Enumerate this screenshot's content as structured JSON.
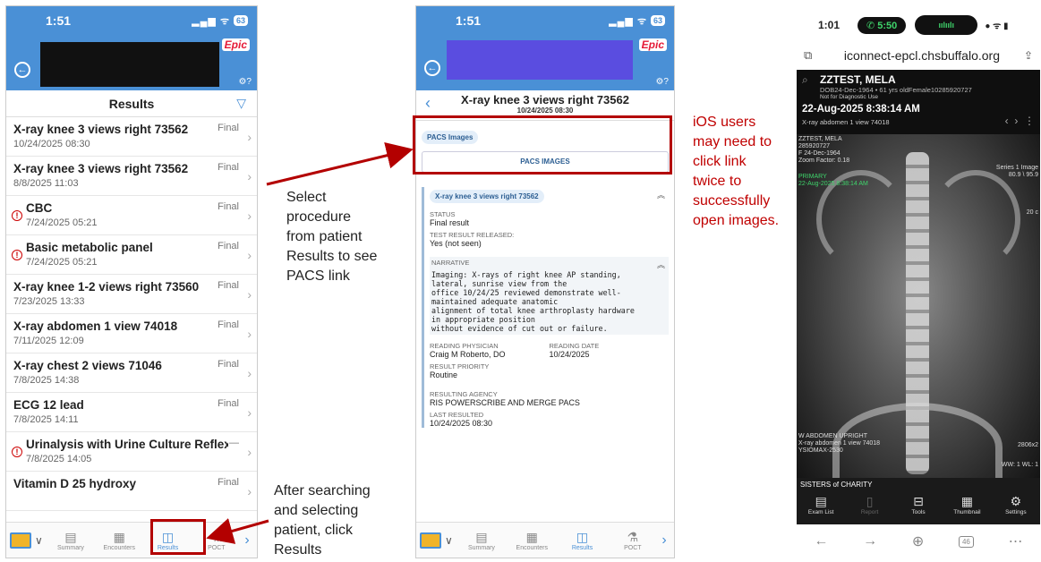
{
  "phone1": {
    "status_time": "1:51",
    "battery": "63",
    "header_logo": "Epic",
    "screen_title": "Results",
    "results": [
      {
        "name": "X-ray knee 3 views right 73562",
        "date": "10/24/2025 08:30",
        "status": "Final",
        "alert": false
      },
      {
        "name": "X-ray knee 3 views right 73562",
        "date": "8/8/2025 11:03",
        "status": "Final",
        "alert": false
      },
      {
        "name": "CBC",
        "date": "7/24/2025 05:21",
        "status": "Final",
        "alert": true
      },
      {
        "name": "Basic metabolic panel",
        "date": "7/24/2025 05:21",
        "status": "Final",
        "alert": true
      },
      {
        "name": "X-ray knee 1-2 views right 73560",
        "date": "7/23/2025 13:33",
        "status": "Final",
        "alert": false
      },
      {
        "name": "X-ray abdomen 1 view 74018",
        "date": "7/11/2025 12:09",
        "status": "Final",
        "alert": false
      },
      {
        "name": "X-ray chest 2 views 71046",
        "date": "7/8/2025 14:38",
        "status": "Final",
        "alert": false
      },
      {
        "name": "ECG 12 lead",
        "date": "7/8/2025 14:11",
        "status": "Final",
        "alert": false
      },
      {
        "name": "Urinalysis with Urine Culture Reflex",
        "date": "7/8/2025 14:05",
        "status": "—",
        "alert": true
      },
      {
        "name": "Vitamin D 25 hydroxy",
        "date": "",
        "status": "Final",
        "alert": false
      }
    ],
    "tabs": [
      "Summary",
      "Encounters",
      "Results",
      "POCT"
    ]
  },
  "phone2": {
    "status_time": "1:51",
    "battery": "63",
    "header_logo": "Epic",
    "title": "X-ray knee 3 views right 73562",
    "subtitle": "10/24/2025 08:30",
    "pacs_chip": "PACS Images",
    "pacs_button": "PACS IMAGES",
    "section_chip": "X-ray knee 3 views right 73562",
    "status_label": "STATUS",
    "status_value": "Final result",
    "released_label": "TEST RESULT RELEASED:",
    "released_value": "Yes (not seen)",
    "narrative_label": "NARRATIVE",
    "narrative": "Imaging: X-rays of right knee AP standing,\nlateral, sunrise view from the\noffice 10/24/25 reviewed demonstrate well-\nmaintained adequate anatomic\nalignment of total knee arthroplasty hardware\nin appropriate position\nwithout evidence of cut out or failure.",
    "reading_physician_label": "READING PHYSICIAN",
    "reading_physician": "Craig M Roberto, DO",
    "reading_date_label": "READING DATE",
    "reading_date": "10/24/2025",
    "priority_label": "RESULT PRIORITY",
    "priority": "Routine",
    "agency_label": "RESULTING AGENCY",
    "agency": "RIS POWERSCRIBE AND MERGE PACS",
    "last_resulted_label": "LAST RESULTED",
    "last_resulted": "10/24/2025 08:30",
    "tabs": [
      "Summary",
      "Encounters",
      "Results",
      "POCT"
    ]
  },
  "phone3": {
    "status_time": "1:01",
    "call_time": "5:50",
    "url": "iconnect-epcl.chsbuffalo.org",
    "patient_name": "ZZTEST, MELA",
    "patient_dob": "DOB24-Dec-1964 • 61 yrs oldFemale10285920727",
    "not_diagnostic": "Not for Diagnostic Use",
    "study_date": "22-Aug-2025 8:38:14 AM",
    "study_desc": "X-ray abdomen 1 view 74018",
    "overlay_name": "ZZTEST, MELA",
    "overlay_id": "285920727",
    "overlay_dob": "F 24-Dec-1964",
    "overlay_zoom": "Zoom Factor: 0.18",
    "overlay_primary": "PRIMARY",
    "overlay_primary_date": "22-Aug-2025 8:38:14 AM",
    "overlay_series": "Series 1 Image",
    "overlay_size": "80.9 \\ 95.9",
    "overlay_cm": "20 c",
    "overlay_bottom1": "W ABDOMEN UPRIGHT",
    "overlay_bottom2": "X-ray abdomen 1 view 74018",
    "overlay_bottom3": "YSIOMAX-2530",
    "overlay_dims": "2806x2",
    "overlay_wl": "WW: 1 WL: 1",
    "institution": "SISTERS of CHARITY",
    "toolbar": [
      "Exam List",
      "Report",
      "Tools",
      "Thumbnail",
      "Settings"
    ],
    "tabs_count": "46"
  },
  "annotations": {
    "select_text": "Select\nprocedure\nfrom patient\nResults to see\nPACS link",
    "search_text": "After searching\nand selecting\npatient, click\nResults",
    "ios_text": "iOS users\nmay need to\nclick link\ntwice to\nsuccessfully\nopen images."
  },
  "colors": {
    "epic_blue": "#4a90d6",
    "highlight_red": "#b30000",
    "annotation_red": "#c00000"
  }
}
